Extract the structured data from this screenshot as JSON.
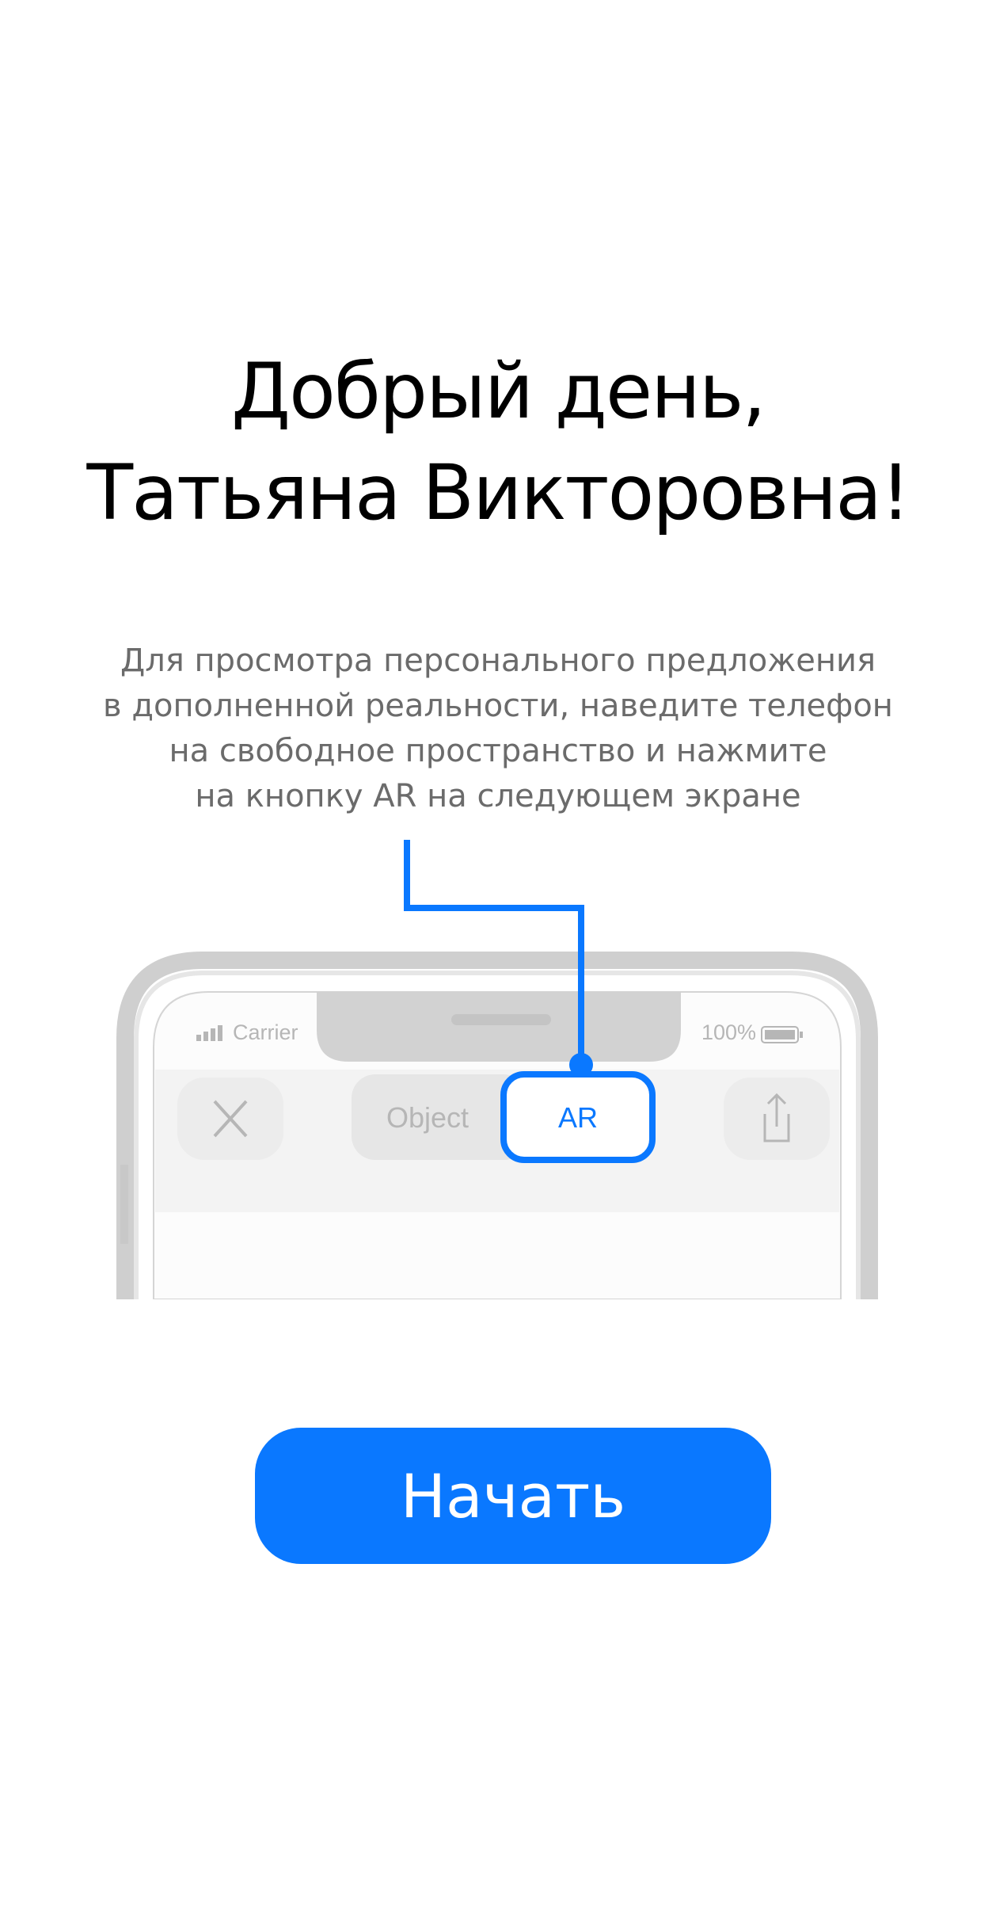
{
  "greeting": {
    "line1": "Добрый день,",
    "line2": "Татьяна Викторовна!"
  },
  "instructions": {
    "line1": "Для просмотра персонального предложения",
    "line2": "в дополненной реальности, наведите телефон",
    "line3": "на свободное пространство и нажмите",
    "line4": "на кнопку AR на следующем экране"
  },
  "illustration": {
    "carrier": "Carrier",
    "battery": "100%",
    "segment_object": "Object",
    "segment_ar": "AR",
    "close_icon": "close-icon",
    "share_icon": "share-icon",
    "accent_color": "#0a78ff"
  },
  "start_button": {
    "label": "Начать"
  }
}
